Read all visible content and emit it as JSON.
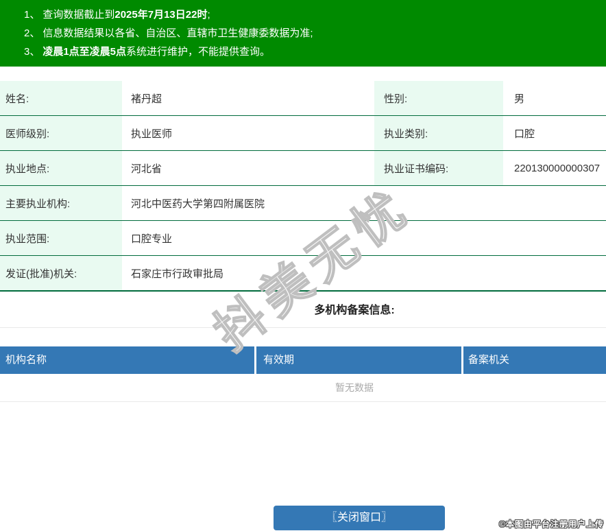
{
  "notices": {
    "items": [
      {
        "num": "1、",
        "parts": [
          {
            "text": "查询数据截止到",
            "bold": false
          },
          {
            "text": "2025年7月13日22时",
            "bold": true
          },
          {
            "text": ";",
            "bold": false
          }
        ]
      },
      {
        "num": "2、",
        "parts": [
          {
            "text": "信息数据结果以各省、自治区、直辖市卫生健康委数据为准;",
            "bold": false
          }
        ]
      },
      {
        "num": "3、",
        "parts": [
          {
            "text": "凌晨1点至凌晨5点",
            "bold": true
          },
          {
            "text": "系统进行维护，不能提供查询。",
            "bold": false
          }
        ]
      }
    ]
  },
  "info": {
    "rows": [
      {
        "label1": "姓名:",
        "value1": "褚丹超",
        "label2": "性别:",
        "value2": "男"
      },
      {
        "label1": "医师级别:",
        "value1": "执业医师",
        "label2": "执业类别:",
        "value2": "口腔"
      },
      {
        "label1": "执业地点:",
        "value1": "河北省",
        "label2": "执业证书编码:",
        "value2": "220130000000307"
      },
      {
        "label1": "主要执业机构:",
        "value1": "河北中医药大学第四附属医院"
      },
      {
        "label1": "执业范围:",
        "value1": "口腔专业"
      },
      {
        "label1": "发证(批准)机关:",
        "value1": "石家庄市行政审批局"
      }
    ]
  },
  "multi_org": {
    "heading": "多机构备案信息:",
    "columns": [
      "机构名称",
      "有效期",
      "备案机关"
    ],
    "empty_text": "暂无数据"
  },
  "footer": {
    "close_button": "〖关闭窗口〗",
    "credit": "©本图由平台注册用户上传"
  },
  "watermark": {
    "text": "抖美无忧"
  },
  "colors": {
    "banner_green": "#008A00",
    "label_mint": "#E9FAF1",
    "row_border_green": "#006B3C",
    "header_blue": "#3478B5",
    "button_blue": "#3478B5",
    "empty_text_gray": "#AAAAAA"
  }
}
